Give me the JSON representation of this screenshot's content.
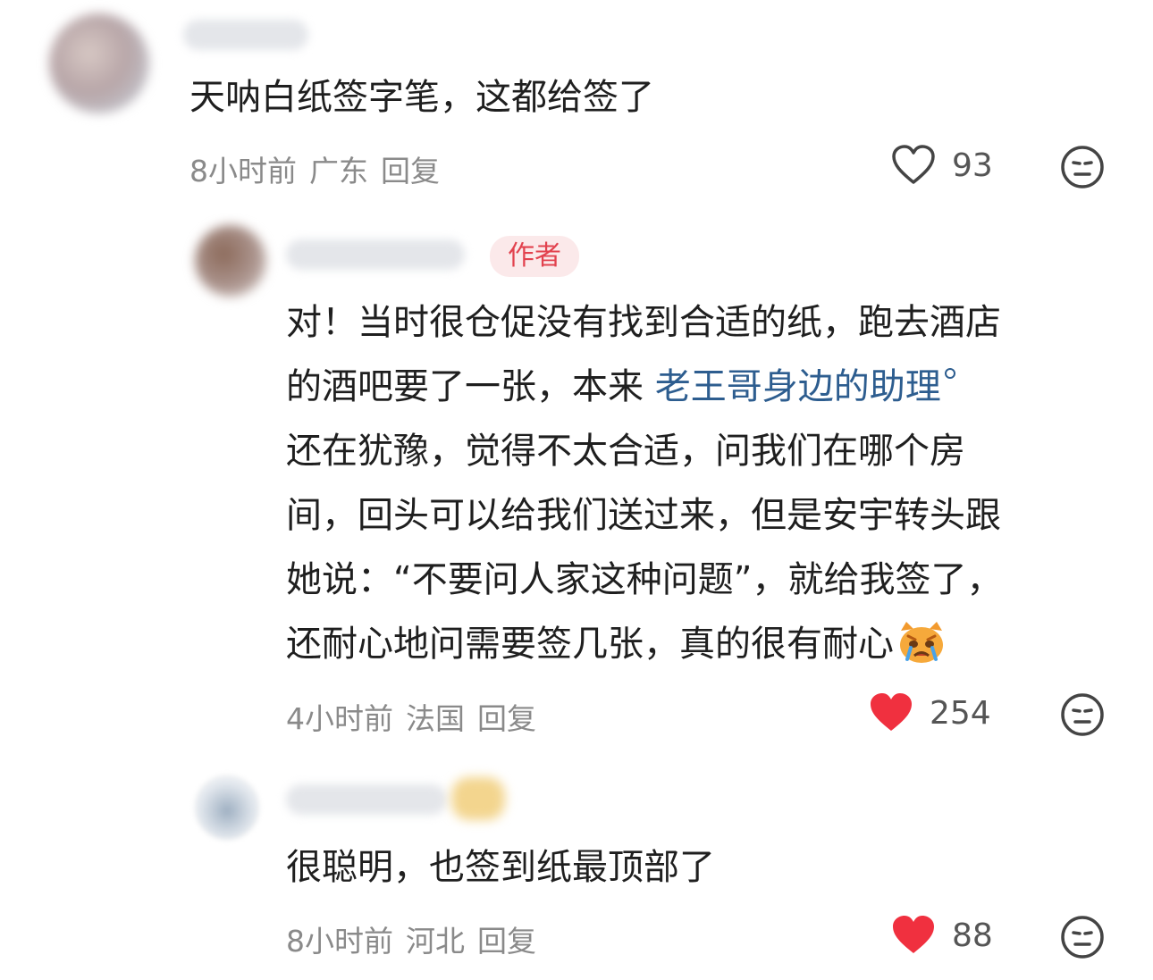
{
  "comments": [
    {
      "text": "天呐白纸签字笔，这都给签了",
      "time": "8小时前",
      "location": "广东",
      "reply_label": "回复",
      "likes": "93",
      "liked": false
    },
    {
      "badge": "作者",
      "lines": [
        "对！当时很仓促没有找到合适的纸，跑去酒店",
        "的酒吧要了一张，本来",
        "还在犹豫，觉得不太合适，问我们在哪个房",
        "间，回头可以给我们送过来，但是安宇转头跟",
        "她说：“不要问人家这种问题”，就给我签了，",
        "还耐心地问需要签几张，真的很有耐心"
      ],
      "link_text": "老王哥身边的助理",
      "time": "4小时前",
      "location": "法国",
      "reply_label": "回复",
      "likes": "254",
      "liked": true
    },
    {
      "text": "很聪明，也签到纸最顶部了",
      "time": "8小时前",
      "location": "河北",
      "reply_label": "回复",
      "likes": "88",
      "liked": true
    }
  ],
  "colors": {
    "like_active": "#f0303f",
    "badge_text": "#e2424e",
    "link": "#2d5d8f"
  }
}
